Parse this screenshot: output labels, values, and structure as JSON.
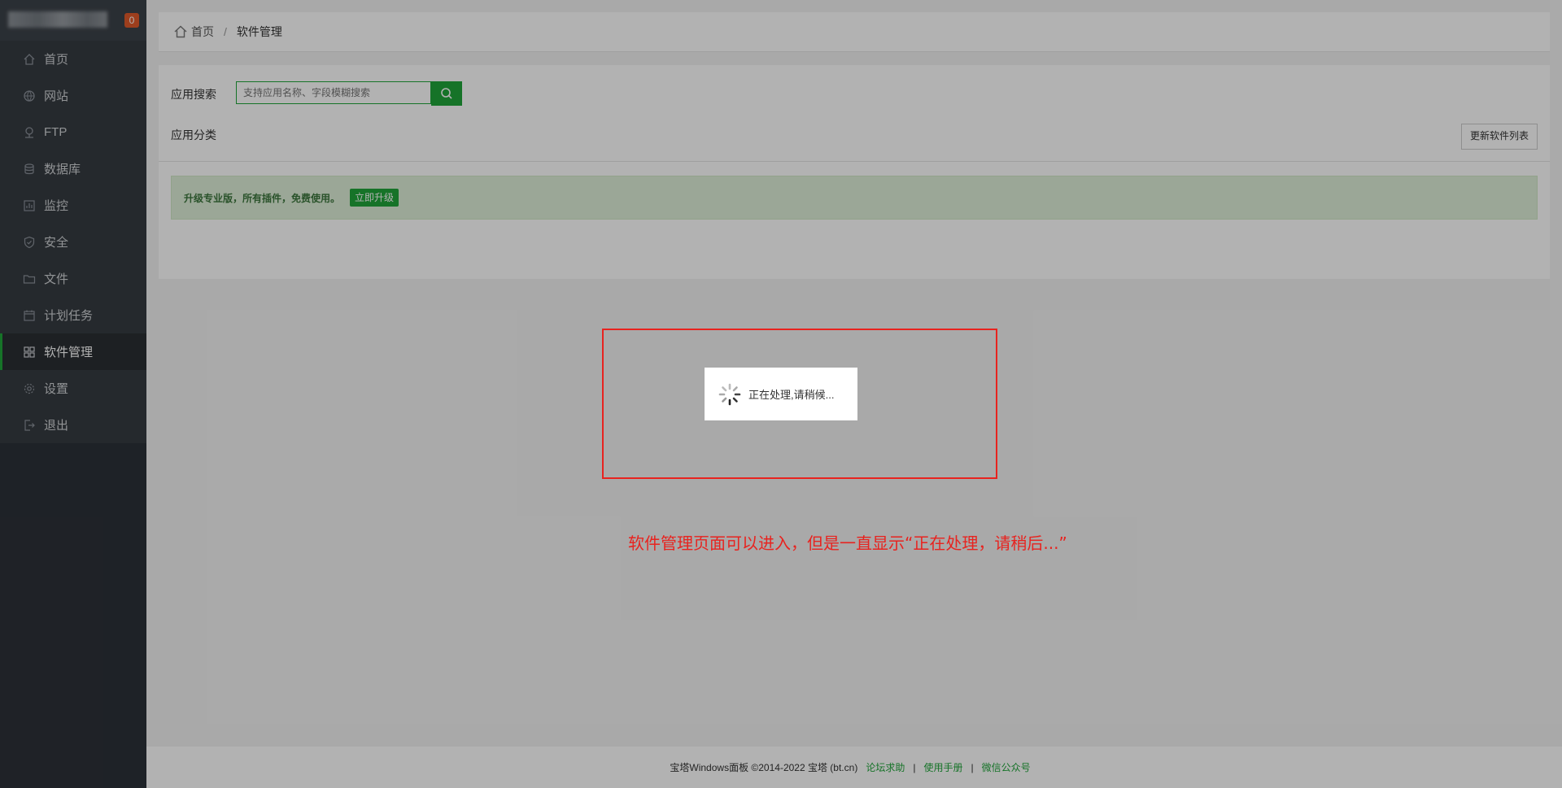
{
  "sidebar": {
    "notice_count": "0",
    "items": [
      {
        "label": "首页",
        "icon": "home-icon"
      },
      {
        "label": "网站",
        "icon": "globe-icon"
      },
      {
        "label": "FTP",
        "icon": "ftp-icon"
      },
      {
        "label": "数据库",
        "icon": "database-icon"
      },
      {
        "label": "监控",
        "icon": "monitor-icon"
      },
      {
        "label": "安全",
        "icon": "shield-icon"
      },
      {
        "label": "文件",
        "icon": "folder-icon"
      },
      {
        "label": "计划任务",
        "icon": "calendar-icon"
      },
      {
        "label": "软件管理",
        "icon": "grid-icon",
        "active": true
      },
      {
        "label": "设置",
        "icon": "gear-icon"
      },
      {
        "label": "退出",
        "icon": "logout-icon"
      }
    ]
  },
  "breadcrumb": {
    "home": "首页",
    "separator": "/",
    "current": "软件管理"
  },
  "soft_panel": {
    "search_label": "应用搜索",
    "search_placeholder": "支持应用名称、字段模糊搜索",
    "category_label": "应用分类",
    "refresh_button": "更新软件列表",
    "upgrade_text": "升级专业版，所有插件，免费使用。",
    "upgrade_button": "立即升级"
  },
  "loading": {
    "text": "正在处理,请稍候..."
  },
  "annotation": {
    "text": "软件管理页面可以进入，但是一直显示“正在处理，请稍后...”"
  },
  "footer": {
    "copyright": "宝塔Windows面板 ©2014-2022 宝塔 (bt.cn)",
    "links": [
      "论坛求助",
      "使用手册",
      "微信公众号"
    ],
    "separator": "|"
  },
  "colors": {
    "accent": "#20a53a",
    "sidebar_bg": "#2c3138",
    "annotation_red": "#e8231f"
  }
}
